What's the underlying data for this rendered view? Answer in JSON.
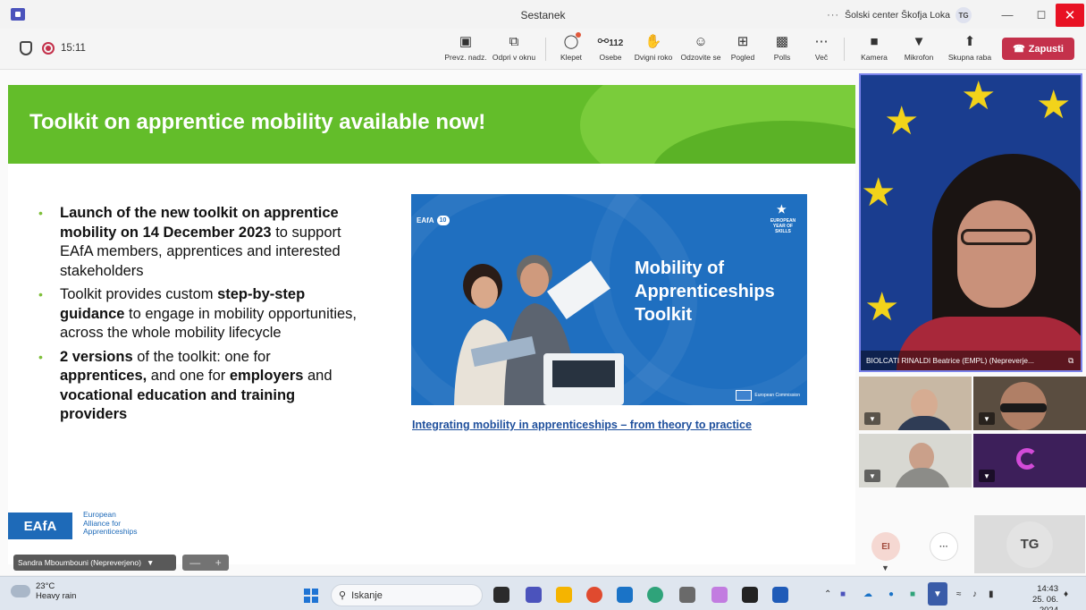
{
  "window": {
    "title": "Sestanek",
    "org": "Šolski center Škofja Loka",
    "org_initials": "TG",
    "more": "···"
  },
  "toolbar": {
    "timer": "15:11",
    "share_label": "Prevz. nadz.",
    "popout_label": "Odpri v oknu",
    "chat_label": "Klepet",
    "people_label": "Osebe",
    "people_count": "112",
    "raise_label": "Dvigni roko",
    "react_label": "Odzovite se",
    "view_label": "Pogled",
    "polls_label": "Polls",
    "more_label": "Več",
    "camera_label": "Kamera",
    "mic_label": "Mikrofon",
    "share_screen_label": "Skupna raba",
    "leave_label": "Zapusti"
  },
  "slide": {
    "title": "Toolkit on apprentice mobility available now!",
    "bullet1_b1": "Launch of the new toolkit on apprentice mobility on 14 December 2023",
    "bullet1_t1": " to support EAfA members, apprentices and interested stakeholders",
    "bullet2_t1": "Toolkit provides custom ",
    "bullet2_b1": "step-by-step guidance",
    "bullet2_t2": " to engage in mobility opportunities, across the whole mobility lifecycle",
    "bullet3_b1": "2 versions",
    "bullet3_t1": " of the toolkit: one for ",
    "bullet3_b2": "apprentices,",
    "bullet3_t2": " and one for ",
    "bullet3_b3": "employers",
    "bullet3_t3": " and ",
    "bullet3_b4": "vocational education and training providers",
    "promo_badge": "EAfA",
    "promo_badge_num": "10",
    "promo_eyos": "EUROPEAN YEAR OF SKILLS",
    "promo_title_1": "Mobility of",
    "promo_title_2": "Apprenticeships",
    "promo_title_3": "Toolkit",
    "promo_ec": "European Commission",
    "link": "Integrating mobility in apprenticeships – from theory to practice",
    "logo": "EAfA",
    "logo_text_1": "European",
    "logo_text_2": "Alliance for",
    "logo_text_3": "Apprenticeships"
  },
  "presenter": {
    "name": "Sandra Mboumbouni (Nepreverjeno)",
    "zoom_out": "—",
    "zoom_in": "+"
  },
  "videos": {
    "main_name": "BIOLCATI RINALDI Beatrice (EMPL) (Nepreverje...",
    "avatar_ei": "EI",
    "avatar_more": "···",
    "avatar_tg": "TG"
  },
  "taskbar": {
    "temp": "23°C",
    "weather": "Heavy rain",
    "search": "Iskanje",
    "time": "14:43",
    "date": "25. 06. 2024"
  },
  "colors": {
    "banner_green": "#63bd2a",
    "teams_purple": "#4b53bc",
    "leave_red": "#c4314b",
    "eafa_blue": "#1e6ab8",
    "link_blue": "#1e4f9c"
  }
}
